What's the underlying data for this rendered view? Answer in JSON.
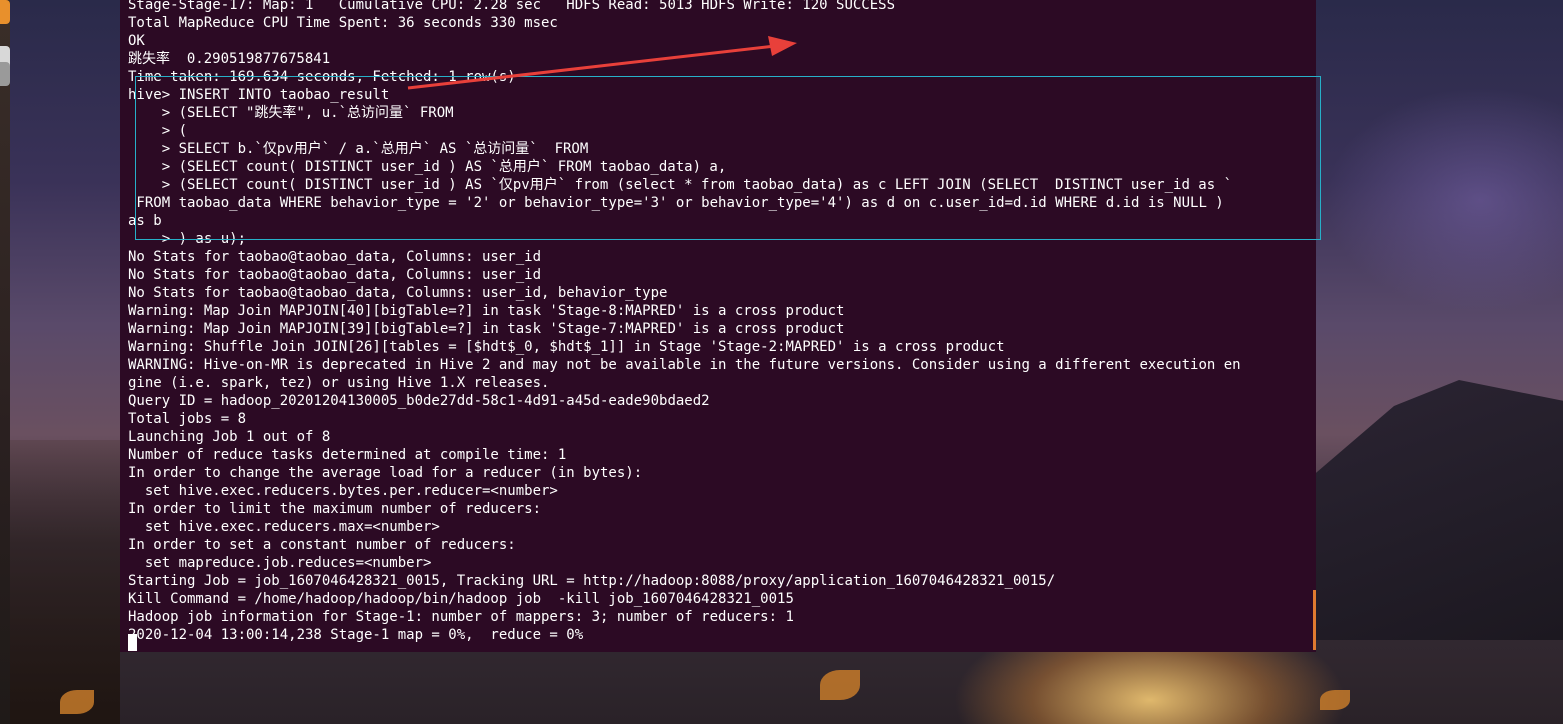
{
  "terminal": {
    "lines": [
      "Stage-Stage-17: Map: 1   Cumulative CPU: 2.28 sec   HDFS Read: 5013 HDFS Write: 120 SUCCESS",
      "Total MapReduce CPU Time Spent: 36 seconds 330 msec",
      "OK",
      "跳失率  0.290519877675841",
      "Time taken: 169.634 seconds, Fetched: 1 row(s)",
      "hive> INSERT INTO taobao_result",
      "    > (SELECT \"跳失率\", u.`总访问量` FROM",
      "    > (",
      "    > SELECT b.`仅pv用户` / a.`总用户` AS `总访问量`  FROM",
      "    > (SELECT count( DISTINCT user_id ) AS `总用户` FROM taobao_data) a,",
      "    > (SELECT count( DISTINCT user_id ) AS `仅pv用户` from (select * from taobao_data) as c LEFT JOIN (SELECT  DISTINCT user_id as `",
      " FROM taobao_data WHERE behavior_type = '2' or behavior_type='3' or behavior_type='4') as d on c.user_id=d.id WHERE d.id is NULL )",
      "as b",
      "    > ) as u);",
      "No Stats for taobao@taobao_data, Columns: user_id",
      "No Stats for taobao@taobao_data, Columns: user_id",
      "No Stats for taobao@taobao_data, Columns: user_id, behavior_type",
      "Warning: Map Join MAPJOIN[40][bigTable=?] in task 'Stage-8:MAPRED' is a cross product",
      "Warning: Map Join MAPJOIN[39][bigTable=?] in task 'Stage-7:MAPRED' is a cross product",
      "Warning: Shuffle Join JOIN[26][tables = [$hdt$_0, $hdt$_1]] in Stage 'Stage-2:MAPRED' is a cross product",
      "WARNING: Hive-on-MR is deprecated in Hive 2 and may not be available in the future versions. Consider using a different execution en",
      "gine (i.e. spark, tez) or using Hive 1.X releases.",
      "Query ID = hadoop_20201204130005_b0de27dd-58c1-4d91-a45d-eade90bdaed2",
      "Total jobs = 8",
      "Launching Job 1 out of 8",
      "Number of reduce tasks determined at compile time: 1",
      "In order to change the average load for a reducer (in bytes):",
      "  set hive.exec.reducers.bytes.per.reducer=<number>",
      "In order to limit the maximum number of reducers:",
      "  set hive.exec.reducers.max=<number>",
      "In order to set a constant number of reducers:",
      "  set mapreduce.job.reduces=<number>",
      "Starting Job = job_1607046428321_0015, Tracking URL = http://hadoop:8088/proxy/application_1607046428321_0015/",
      "Kill Command = /home/hadoop/hadoop/bin/hadoop job  -kill job_1607046428321_0015",
      "Hadoop job information for Stage-1: number of mappers: 3; number of reducers: 1",
      "2020-12-04 13:00:14,238 Stage-1 map = 0%,  reduce = 0%"
    ]
  },
  "colors": {
    "terminal_bg": "#2c0a24",
    "terminal_text": "#ffffff",
    "selection_border": "#27b0c8",
    "annotation_arrow": "#e8403a"
  }
}
